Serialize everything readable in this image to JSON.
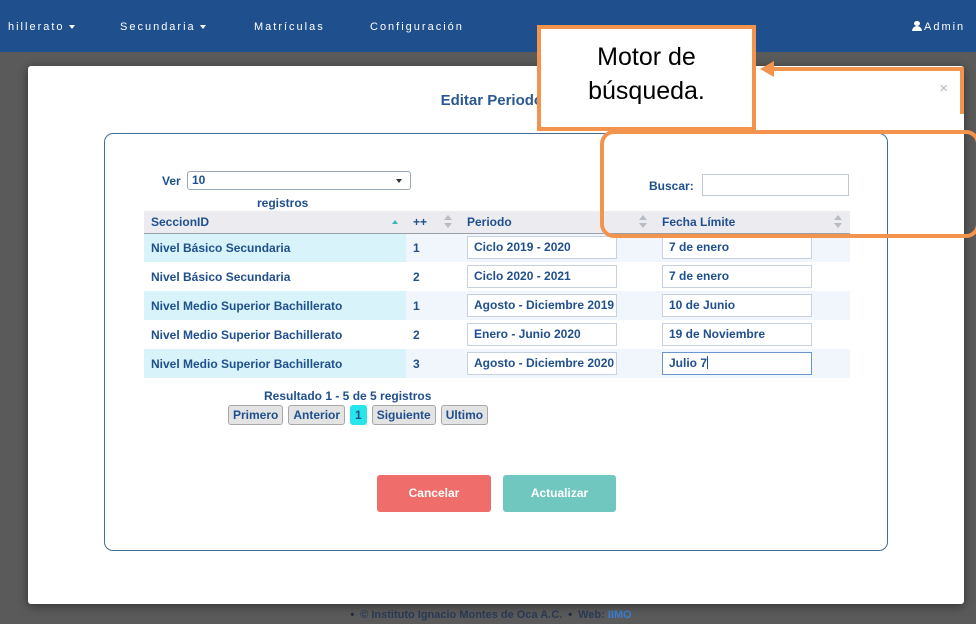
{
  "navbar": {
    "items": [
      "hillerato",
      "Secundaria",
      "Matrículas",
      "Configuración"
    ],
    "user": "Admin"
  },
  "modal": {
    "title": "Editar Periodos",
    "close": "×",
    "length_label_prefix": "Ver",
    "length_value": "10",
    "length_label_suffix": "registros",
    "search_label": "Buscar:",
    "search_value": "",
    "columns": [
      "SeccionID",
      "++",
      "Periodo",
      "Fecha Límite"
    ],
    "rows": [
      {
        "seccion": "Nivel Básico Secundaria",
        "num": "1",
        "periodo": "Ciclo 2019 - 2020",
        "fecha": "7 de enero"
      },
      {
        "seccion": "Nivel Básico Secundaria",
        "num": "2",
        "periodo": "Ciclo 2020 - 2021",
        "fecha": "7 de enero"
      },
      {
        "seccion": "Nivel Medio Superior Bachillerato",
        "num": "1",
        "periodo": "Agosto - Diciembre 2019",
        "fecha": "10 de Junio"
      },
      {
        "seccion": "Nivel Medio Superior Bachillerato",
        "num": "2",
        "periodo": "Enero - Junio 2020",
        "fecha": "19 de Noviembre"
      },
      {
        "seccion": "Nivel Medio Superior Bachillerato",
        "num": "3",
        "periodo": "Agosto - Diciembre 2020",
        "fecha": "Julio 7"
      }
    ],
    "info": "Resultado 1 - 5 de 5 registros",
    "pager": {
      "first": "Primero",
      "prev": "Anterior",
      "current": "1",
      "next": "Siguiente",
      "last": "Ultimo"
    },
    "cancel_label": "Cancelar",
    "update_label": "Actualizar"
  },
  "footer": {
    "copyright": "© Instituto Ignacio Montes de Oca A.C.",
    "web_label": "Web:",
    "web_link": "IIMO"
  },
  "annotation": {
    "line1": "Motor de",
    "line2": "búsqueda."
  },
  "colors": {
    "navbar": "#1f4f8d",
    "text_primary": "#1f4f8d",
    "cancel": "#ef6e6b",
    "update": "#6fc7c0",
    "pager_current": "#27e5ea",
    "annotation": "#f2934e"
  }
}
